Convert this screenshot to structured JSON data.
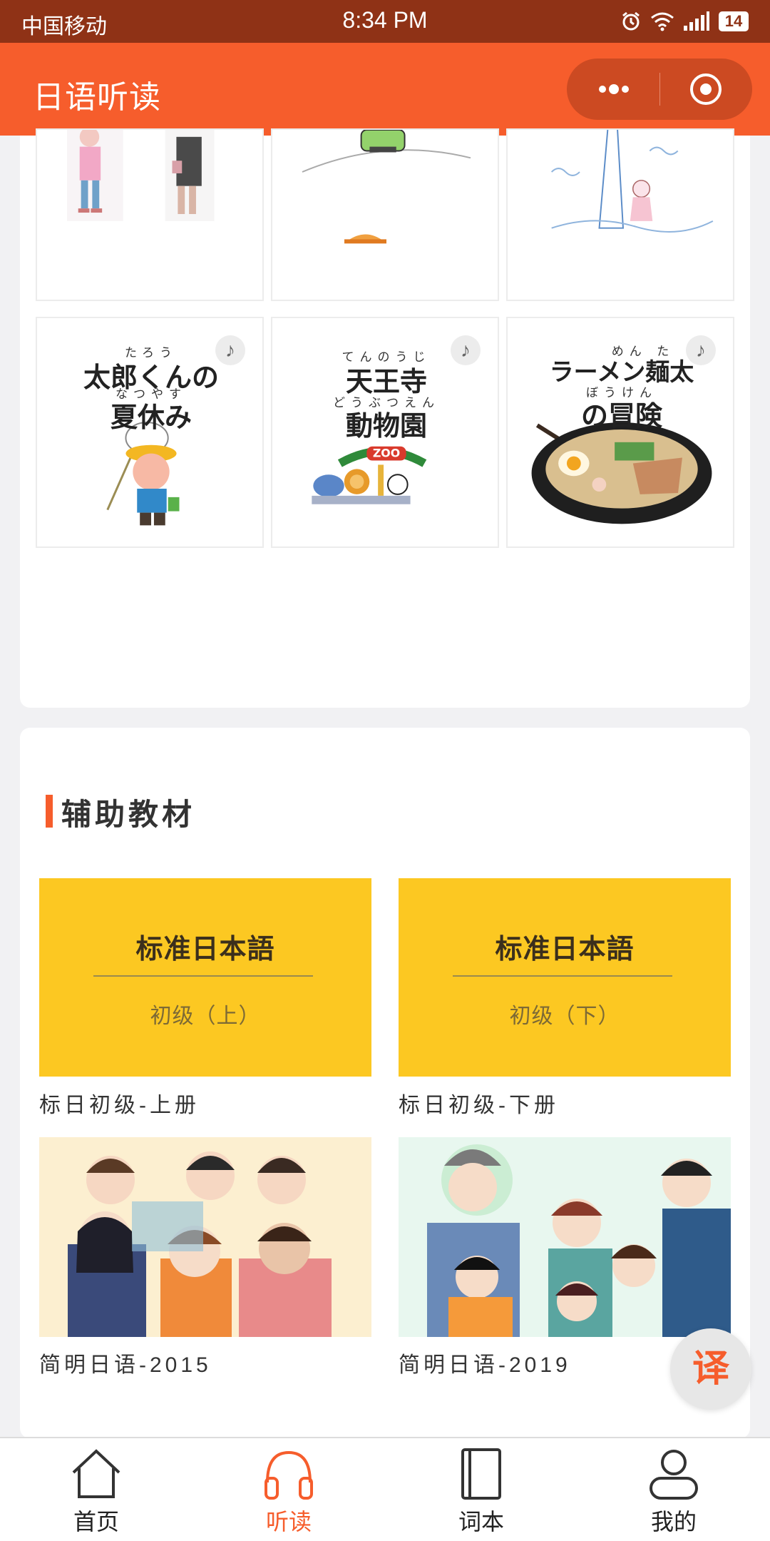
{
  "status_bar": {
    "carrier": "中国移动",
    "time": "8:34 PM",
    "battery": "14"
  },
  "header": {
    "title": "日语听读"
  },
  "stories": [
    {
      "ruby1": "たろう",
      "title1": "太郎くんの",
      "ruby2": "なつやす",
      "title2": "夏休み"
    },
    {
      "ruby1": "てんのうじ",
      "title1": "天王寺",
      "ruby2": "どうぶつえん",
      "title2": "動物園"
    },
    {
      "ruby1": "めん た",
      "title1": "ラーメン麺太",
      "ruby2": "ぼうけん",
      "title2": "の冒険"
    }
  ],
  "section": {
    "title": "辅助教材"
  },
  "books": [
    {
      "cover_title": "标准日本語",
      "cover_subtitle": "初级（上）",
      "caption": "标日初级-上册"
    },
    {
      "cover_title": "标准日本語",
      "cover_subtitle": "初级（下）",
      "caption": "标日初级-下册"
    }
  ],
  "courses": [
    {
      "caption": "简明日语-2015"
    },
    {
      "caption": "简明日语-2019"
    }
  ],
  "fab": {
    "label": "译"
  },
  "tabs": [
    {
      "label": "首页",
      "icon": "home-icon"
    },
    {
      "label": "听读",
      "icon": "headphones-icon"
    },
    {
      "label": "词本",
      "icon": "notebook-icon"
    },
    {
      "label": "我的",
      "icon": "user-icon"
    }
  ],
  "colors": {
    "brand": "#f65d2c",
    "status_bar": "#8f3216",
    "book_cover": "#fcc822"
  }
}
